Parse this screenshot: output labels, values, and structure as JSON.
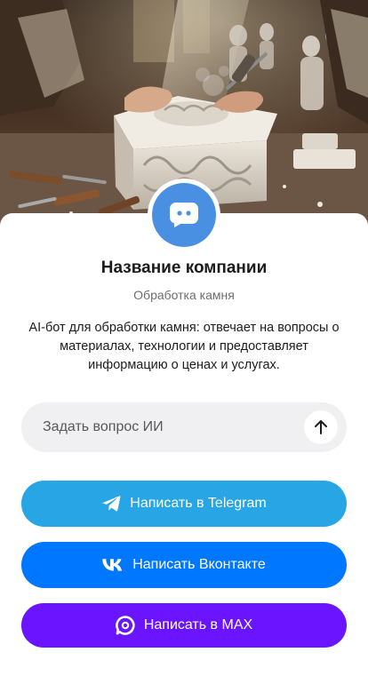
{
  "hero": {
    "image": "stone-carving-workshop-photo"
  },
  "profile": {
    "avatar_icon": "chat-bubble-icon",
    "company_name": "Название компании",
    "company_subtitle": "Обработка камня",
    "description": "AI-бот для обработки камня: отвечает на вопросы о материалах, технологии и предоставляет информацию о ценах и услугах."
  },
  "ask": {
    "placeholder": "Задать вопрос ИИ",
    "value": "",
    "send_icon": "arrow-up-icon"
  },
  "buttons": {
    "telegram": {
      "label": "Написать в Telegram",
      "icon": "telegram-icon",
      "color": "#27a5e5"
    },
    "vk": {
      "label": "Написать Вконтакте",
      "icon": "vk-icon",
      "color": "#0077ff"
    },
    "max": {
      "label": "Написать в MAX",
      "icon": "max-icon",
      "color": "#6a14ff"
    }
  },
  "colors": {
    "avatar": "#4a90e2",
    "ask_background": "#f0f0f2"
  }
}
